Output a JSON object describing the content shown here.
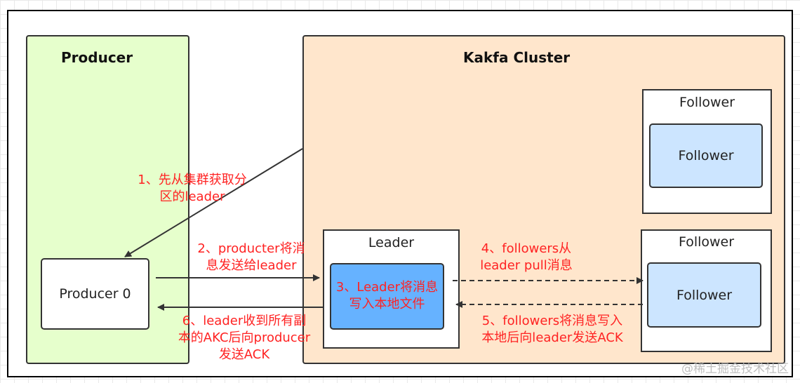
{
  "producer_region": {
    "title": "Producer"
  },
  "cluster_region": {
    "title": "Kakfa Cluster"
  },
  "producer_node": {
    "label": "Producer 0"
  },
  "leader": {
    "label": "Leader",
    "inner_text": "3、Leader将消息\n写入本地文件"
  },
  "follower_top": {
    "outer_label": "Follower",
    "inner_label": "Follower"
  },
  "follower_bottom": {
    "outer_label": "Follower",
    "inner_label": "Follower"
  },
  "steps": {
    "step1": "1、先从集群获取分\n区的leader",
    "step2": "2、producter将消\n息发送给leader",
    "step4": "4、followers从\nleader pull消息",
    "step5": "5、followers将消息写入\n本地后向leader发送ACK",
    "step6": "6、leader收到所有副\n本的AKC后向producer\n发送ACK"
  },
  "watermark": "@稀土掘金技术社区",
  "colors": {
    "producer_bg": "#e6ffcc",
    "cluster_bg": "#ffe6cc",
    "follower_inner_bg": "#cce5ff",
    "leader_inner_bg": "#66b2ff",
    "annotation_text": "#ff2222"
  }
}
